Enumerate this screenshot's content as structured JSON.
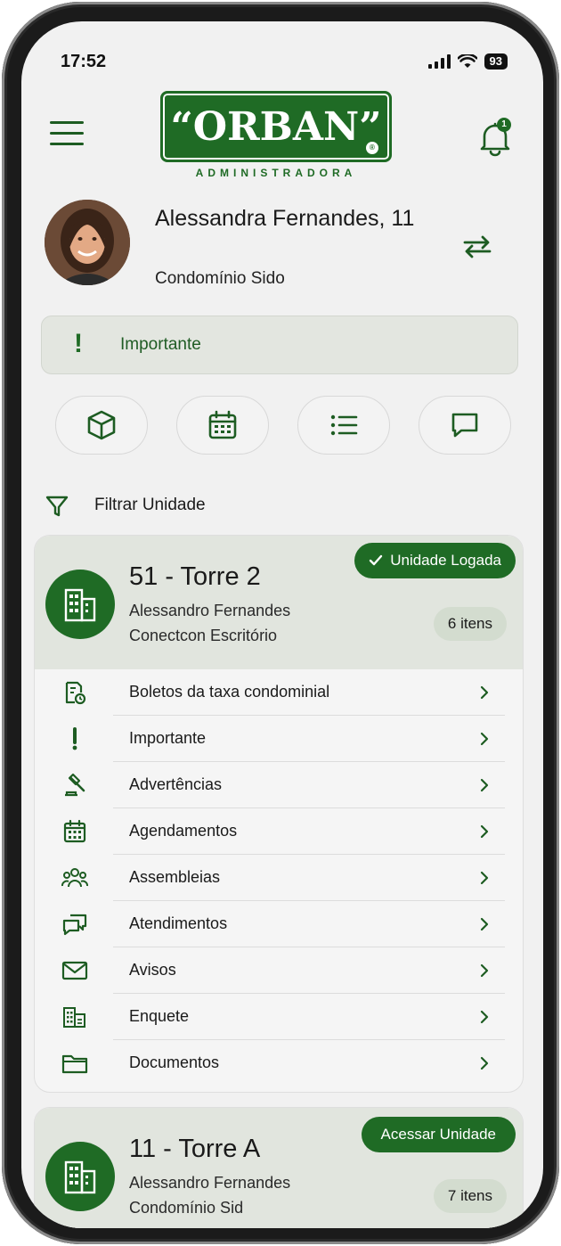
{
  "status_bar": {
    "time": "17:52",
    "battery": "93"
  },
  "header": {
    "logo_text": "“ORBAN”",
    "logo_mark": "®",
    "logo_subtitle": "ADMINISTRADORA",
    "notification_count": "1"
  },
  "profile": {
    "name": "Alessandra Fernandes, 11",
    "condo": "Condomínio Sido"
  },
  "banner": {
    "icon": "!",
    "label": "Importante"
  },
  "quick_actions": [
    {
      "icon": "box-icon"
    },
    {
      "icon": "calendar-icon"
    },
    {
      "icon": "list-icon"
    },
    {
      "icon": "chat-icon"
    }
  ],
  "filter": {
    "label": "Filtrar Unidade"
  },
  "units": [
    {
      "title": "51 - Torre 2",
      "owner": "Alessandro Fernandes",
      "condo": "Conectcon Escritório",
      "status_badge": "Unidade Logada",
      "items_count": "6 itens",
      "menu": [
        {
          "label": "Boletos da taxa condominial",
          "icon": "invoice-icon"
        },
        {
          "label": "Importante",
          "icon": "exclamation-icon"
        },
        {
          "label": "Advertências",
          "icon": "gavel-icon"
        },
        {
          "label": "Agendamentos",
          "icon": "calendar-icon"
        },
        {
          "label": "Assembleias",
          "icon": "people-icon"
        },
        {
          "label": "Atendimentos",
          "icon": "chat-bubbles-icon"
        },
        {
          "label": "Avisos",
          "icon": "envelope-icon"
        },
        {
          "label": "Enquete",
          "icon": "building-poll-icon"
        },
        {
          "label": "Documentos",
          "icon": "folder-icon"
        }
      ]
    },
    {
      "title": "11 - Torre A",
      "owner": "Alessandro Fernandes",
      "condo": "Condomínio Sid",
      "action_button": "Acessar Unidade",
      "items_count": "7 itens"
    }
  ],
  "colors": {
    "brand_green": "#1f6b25",
    "background": "#f1f1f1",
    "card_head": "#e1e5de"
  }
}
